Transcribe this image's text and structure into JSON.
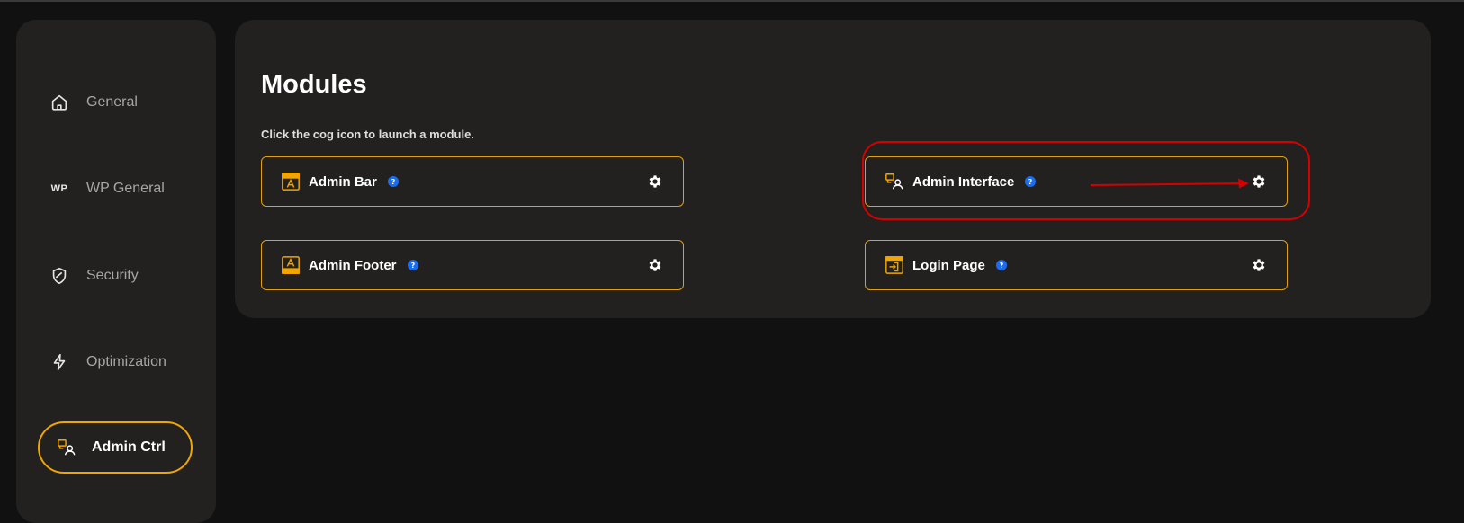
{
  "sidebar": {
    "items": [
      {
        "label": "General",
        "icon": "home-icon"
      },
      {
        "label": "WP General",
        "icon": "wp-icon",
        "icon_text": "WP"
      },
      {
        "label": "Security",
        "icon": "shield-icon"
      },
      {
        "label": "Optimization",
        "icon": "lightning-icon"
      },
      {
        "label": "Admin Ctrl",
        "icon": "admin-ctrl-icon",
        "active": true
      }
    ]
  },
  "main": {
    "title": "Modules",
    "subtitle": "Click the cog icon to launch a module.",
    "modules": [
      {
        "label": "Admin Bar",
        "icon": "admin-bar-icon"
      },
      {
        "label": "Admin Interface",
        "icon": "admin-interface-icon",
        "highlighted": true
      },
      {
        "label": "Admin Footer",
        "icon": "admin-footer-icon"
      },
      {
        "label": "Login Page",
        "icon": "login-page-icon"
      }
    ]
  },
  "colors": {
    "accent": "#f0a500",
    "help": "#1a6cf0",
    "annotation": "#d60000",
    "panel": "#222120",
    "background": "#111111"
  }
}
